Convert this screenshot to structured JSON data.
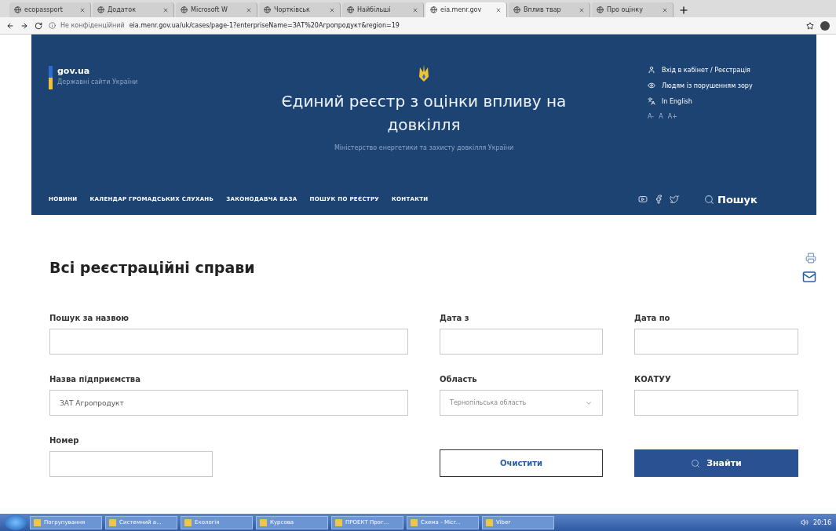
{
  "browser": {
    "tabs": [
      {
        "title": "ecopassport",
        "selected": false
      },
      {
        "title": "Додаток",
        "selected": false
      },
      {
        "title": "Microsoft W",
        "selected": false
      },
      {
        "title": "Чортківськ",
        "selected": false
      },
      {
        "title": "Найбільші",
        "selected": false
      },
      {
        "title": "eia.menr.gov",
        "selected": true
      },
      {
        "title": "Вплив твар",
        "selected": false
      },
      {
        "title": "Про оцінку",
        "selected": false
      }
    ],
    "security": "Не конфіденційний",
    "url": "eia.menr.gov.ua/uk/cases/page-1?enterpriseName=ЗАТ%20Агропродукт&region=19"
  },
  "header": {
    "brand": "gov.ua",
    "brand_subtitle": "Державні сайти України",
    "title": "Єдиний реєстр з оцінки впливу на довкілля",
    "subtitle": "Міністерство енергетики та захисту довкілля України",
    "links": [
      {
        "kind": "user",
        "label": "Вхід в кабінет / Реєстрація"
      },
      {
        "kind": "eye",
        "label": "Людям із порушенням зору"
      },
      {
        "kind": "lang",
        "label": "In English"
      }
    ],
    "font_sizes": [
      "A-",
      "A",
      "A+"
    ],
    "nav": [
      "НОВИНИ",
      "КАЛЕНДАР ГРОМАДСЬКИХ СЛУХАНЬ",
      "ЗАКОНОДАВЧА БАЗА",
      "ПОШУК ПО РЕЄСТРУ",
      "КОНТАКТИ"
    ],
    "search": "Пошук"
  },
  "page": {
    "heading": "Всі реєстраційні справи",
    "fields": [
      {
        "kind": "input",
        "label": "Пошук за назвою"
      },
      {
        "kind": "input",
        "label": "Дата з"
      },
      {
        "kind": "input",
        "label": "Дата по"
      },
      {
        "kind": "input",
        "label": "Назва підприємства",
        "value": "ЗАТ Агропродукт"
      },
      {
        "kind": "select",
        "label": "Область",
        "value": "Тернопільська область"
      },
      {
        "kind": "input",
        "label": "КОАТУУ"
      },
      {
        "kind": "input",
        "label": "Номер"
      }
    ],
    "clear_button": "Очистити",
    "find_button": "Знайти"
  },
  "taskbar": {
    "items": [
      "Погрупування",
      "Системний а...",
      "Екологія",
      "Курсова",
      "ПРОЕКТ Прог...",
      "Схема - Micr...",
      "Viber"
    ],
    "time": "20:16"
  }
}
